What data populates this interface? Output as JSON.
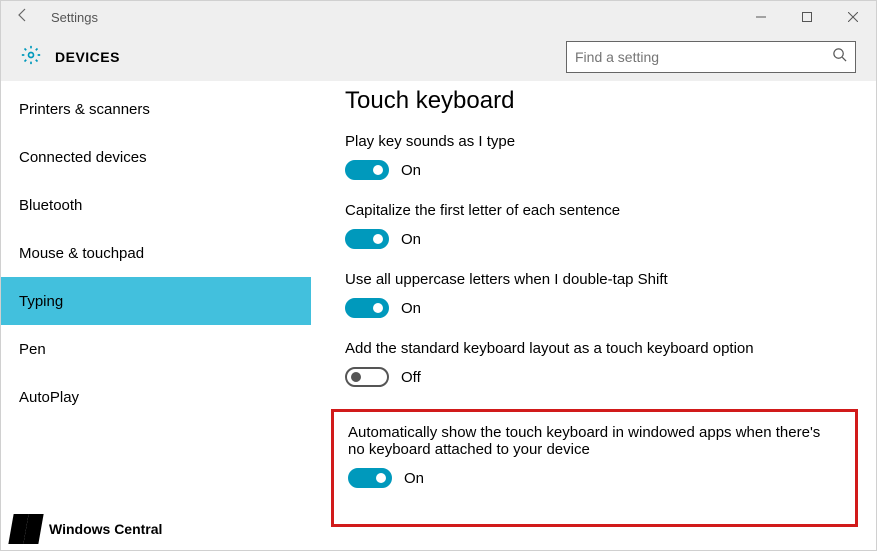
{
  "titlebar": {
    "title": "Settings"
  },
  "header": {
    "section": "DEVICES"
  },
  "search": {
    "placeholder": "Find a setting"
  },
  "sidebar": {
    "items": [
      {
        "label": "Printers & scanners"
      },
      {
        "label": "Connected devices"
      },
      {
        "label": "Bluetooth"
      },
      {
        "label": "Mouse & touchpad"
      },
      {
        "label": "Typing"
      },
      {
        "label": "Pen"
      },
      {
        "label": "AutoPlay"
      }
    ],
    "active_index": 4
  },
  "content": {
    "title": "Touch keyboard",
    "settings": [
      {
        "label": "Play key sounds as I type",
        "value": true,
        "state": "On"
      },
      {
        "label": "Capitalize the first letter of each sentence",
        "value": true,
        "state": "On"
      },
      {
        "label": "Use all uppercase letters when I double-tap Shift",
        "value": true,
        "state": "On"
      },
      {
        "label": "Add the standard keyboard layout as a touch keyboard option",
        "value": false,
        "state": "Off"
      },
      {
        "label": "Automatically show the touch keyboard in windowed apps when there's no keyboard attached to your device",
        "value": true,
        "state": "On"
      }
    ],
    "highlight_index": 4
  },
  "watermark": {
    "text": "Windows Central"
  }
}
